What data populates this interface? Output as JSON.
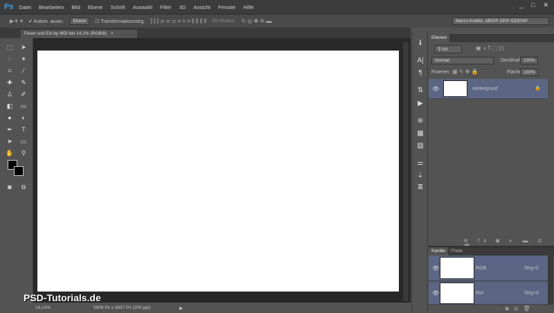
{
  "app": {
    "logo": "Ps",
    "menu": [
      "Datei",
      "Bearbeiten",
      "Bild",
      "Ebene",
      "Schrift",
      "Auswahl",
      "Filter",
      "3D",
      "Ansicht",
      "Fenster",
      "Hilfe"
    ],
    "window_buttons": [
      "_",
      "□",
      "✕"
    ]
  },
  "options": {
    "auto_select_label": "Autom. ausw.:",
    "auto_select_value": "Ebene",
    "transform_label": "Transformationsstrg.",
    "mode3d_label": "3D-Modus:",
    "workspace": "Marco Kolditz, MEER DER IDEEN®"
  },
  "document": {
    "tab_title": "Feuer und Eis by MDI bei 14,1% (RGB/8)",
    "close": "×"
  },
  "status": {
    "zoom": "14,14%",
    "dimensions": "5906 Px x 3937 Px (200 ppi)",
    "arrow": "▶"
  },
  "watermark": "PSD-Tutorials.de",
  "layers_panel": {
    "tab": "Ebenen",
    "filter_label": "Art",
    "blend_mode": "Normal",
    "opacity_label": "Deckkraft:",
    "opacity": "100%",
    "lock_label": "Fixieren:",
    "fill_label": "Fläche:",
    "fill": "100%",
    "layers": [
      {
        "name": "Hintergrund",
        "locked": true
      }
    ],
    "footer_icons": [
      "⊖",
      "fx",
      "◙",
      "◐",
      "▬",
      "◘",
      "🗑"
    ]
  },
  "channels_panel": {
    "tabs": [
      "Kanäle",
      "Pfade"
    ],
    "channels": [
      {
        "name": "RGB",
        "shortcut": "Strg+2"
      },
      {
        "name": "Rot",
        "shortcut": "Strg+3"
      }
    ]
  }
}
